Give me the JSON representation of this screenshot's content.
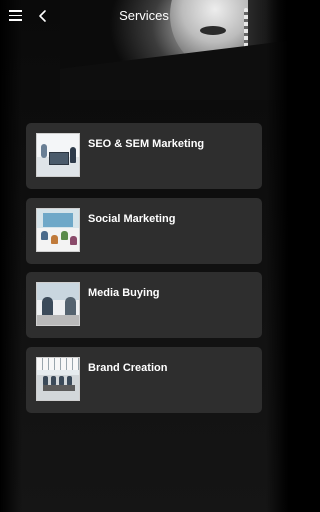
{
  "header": {
    "title": "Services",
    "menu_icon": "hamburger-menu-icon",
    "back_icon": "chevron-left-icon"
  },
  "services": [
    {
      "label": "SEO & SEM Marketing",
      "thumb": "office-workers-photo"
    },
    {
      "label": "Social Marketing",
      "thumb": "presentation-meeting-photo"
    },
    {
      "label": "Media Buying",
      "thumb": "business-handshake-photo"
    },
    {
      "label": "Brand Creation",
      "thumb": "conference-room-photo"
    }
  ],
  "colors": {
    "background": "#111111",
    "card": "#2e2e2e",
    "text": "#ffffff"
  }
}
